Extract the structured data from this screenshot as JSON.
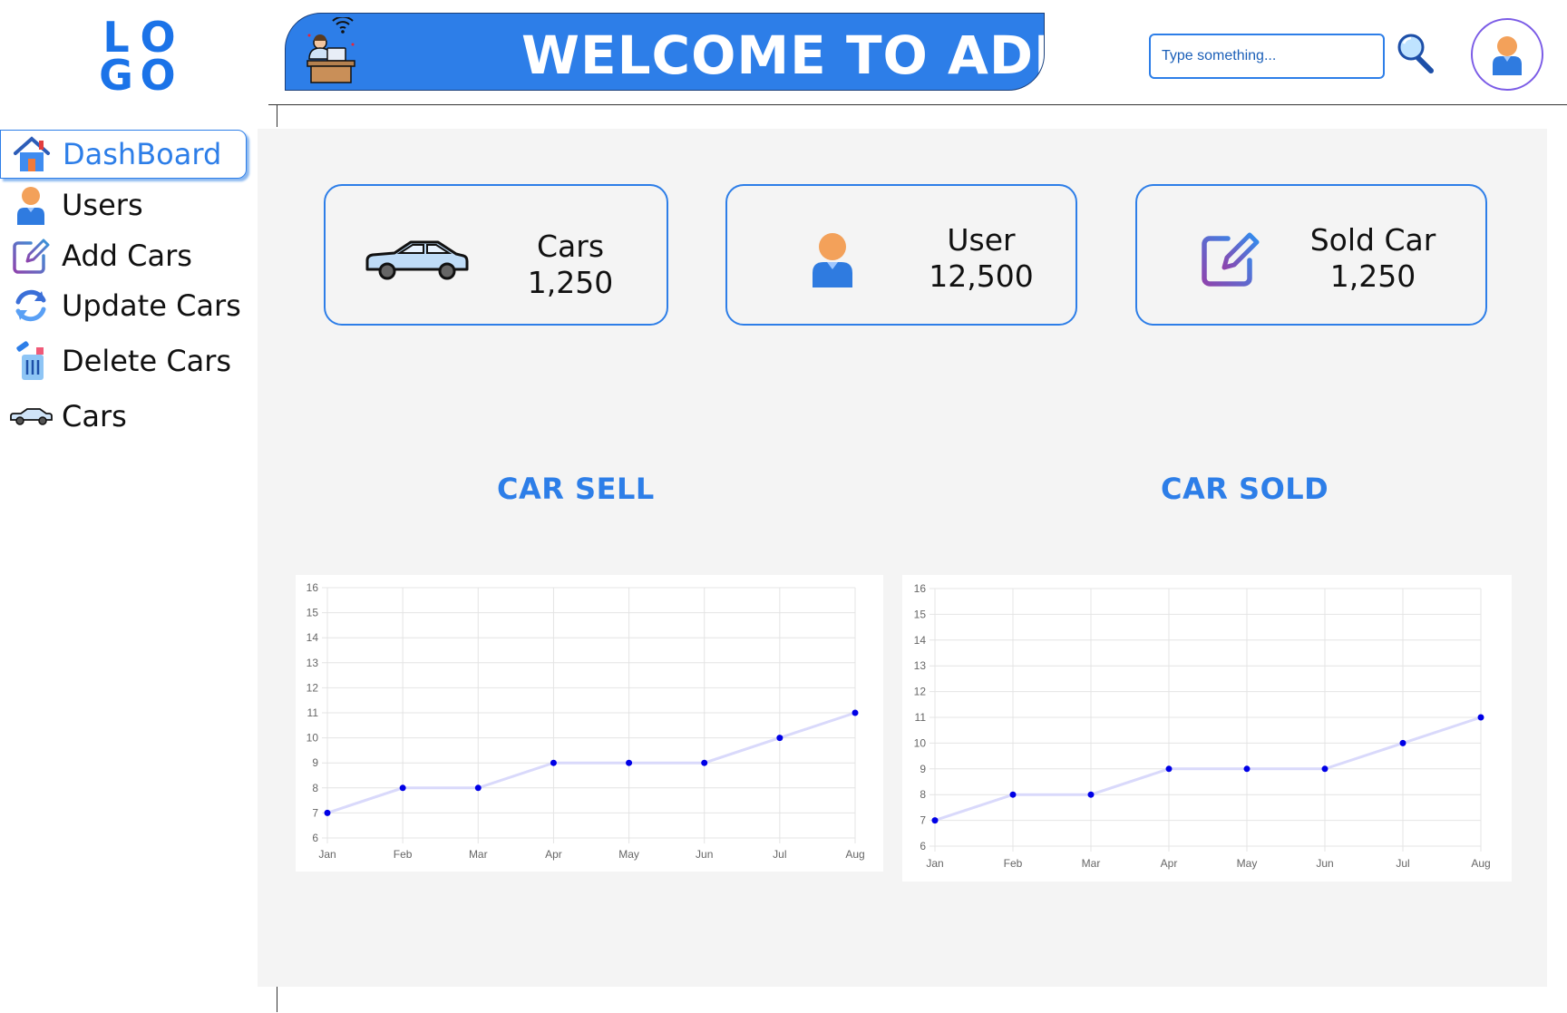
{
  "logo": {
    "line1": [
      "L",
      "O"
    ],
    "line2": [
      "G",
      "O"
    ]
  },
  "header": {
    "title": "WELCOME TO ADMIN",
    "search_placeholder": "Type something...",
    "search_value": ""
  },
  "sidebar": {
    "items": [
      {
        "label": "DashBoard",
        "icon": "home-icon",
        "active": true
      },
      {
        "label": "Users",
        "icon": "user-icon",
        "active": false
      },
      {
        "label": "Add Cars",
        "icon": "edit-icon",
        "active": false
      },
      {
        "label": "Update Cars",
        "icon": "refresh-icon",
        "active": false
      },
      {
        "label": "Delete Cars",
        "icon": "trash-icon",
        "active": false
      },
      {
        "label": "Cars",
        "icon": "car-icon",
        "active": false
      }
    ]
  },
  "stats": [
    {
      "label": "Cars",
      "value": "1,250",
      "icon": "car-icon"
    },
    {
      "label": "User",
      "value": "12,500",
      "icon": "user-icon"
    },
    {
      "label": "Sold Car",
      "value": "1,250",
      "icon": "edit-icon"
    }
  ],
  "sections": {
    "left_title": "CAR SELL",
    "right_title": "CAR SOLD"
  },
  "colors": {
    "accent": "#2d7ee8",
    "panel": "#f4f4f4",
    "point": "#0000e6",
    "line": "#d9d9fb"
  },
  "chart_data": [
    {
      "type": "line",
      "categories": [
        "Jan",
        "Feb",
        "Mar",
        "Apr",
        "May",
        "Jun",
        "Jul",
        "Aug"
      ],
      "series": [
        {
          "values": [
            7,
            8,
            8,
            9,
            9,
            9,
            10,
            11
          ]
        }
      ],
      "ylim": [
        6,
        16
      ],
      "yticks": [
        "6",
        "7",
        "8",
        "9",
        "10",
        "11",
        "12",
        "13",
        "14",
        "15",
        "16"
      ],
      "grid": true
    },
    {
      "type": "line",
      "categories": [
        "Jan",
        "Feb",
        "Mar",
        "Apr",
        "May",
        "Jun",
        "Jul",
        "Aug"
      ],
      "series": [
        {
          "values": [
            7,
            8,
            8,
            9,
            9,
            9,
            10,
            11
          ]
        }
      ],
      "ylim": [
        6,
        16
      ],
      "yticks": [
        "6",
        "7",
        "8",
        "9",
        "10",
        "11",
        "12",
        "13",
        "14",
        "15",
        "16"
      ],
      "grid": true
    }
  ]
}
